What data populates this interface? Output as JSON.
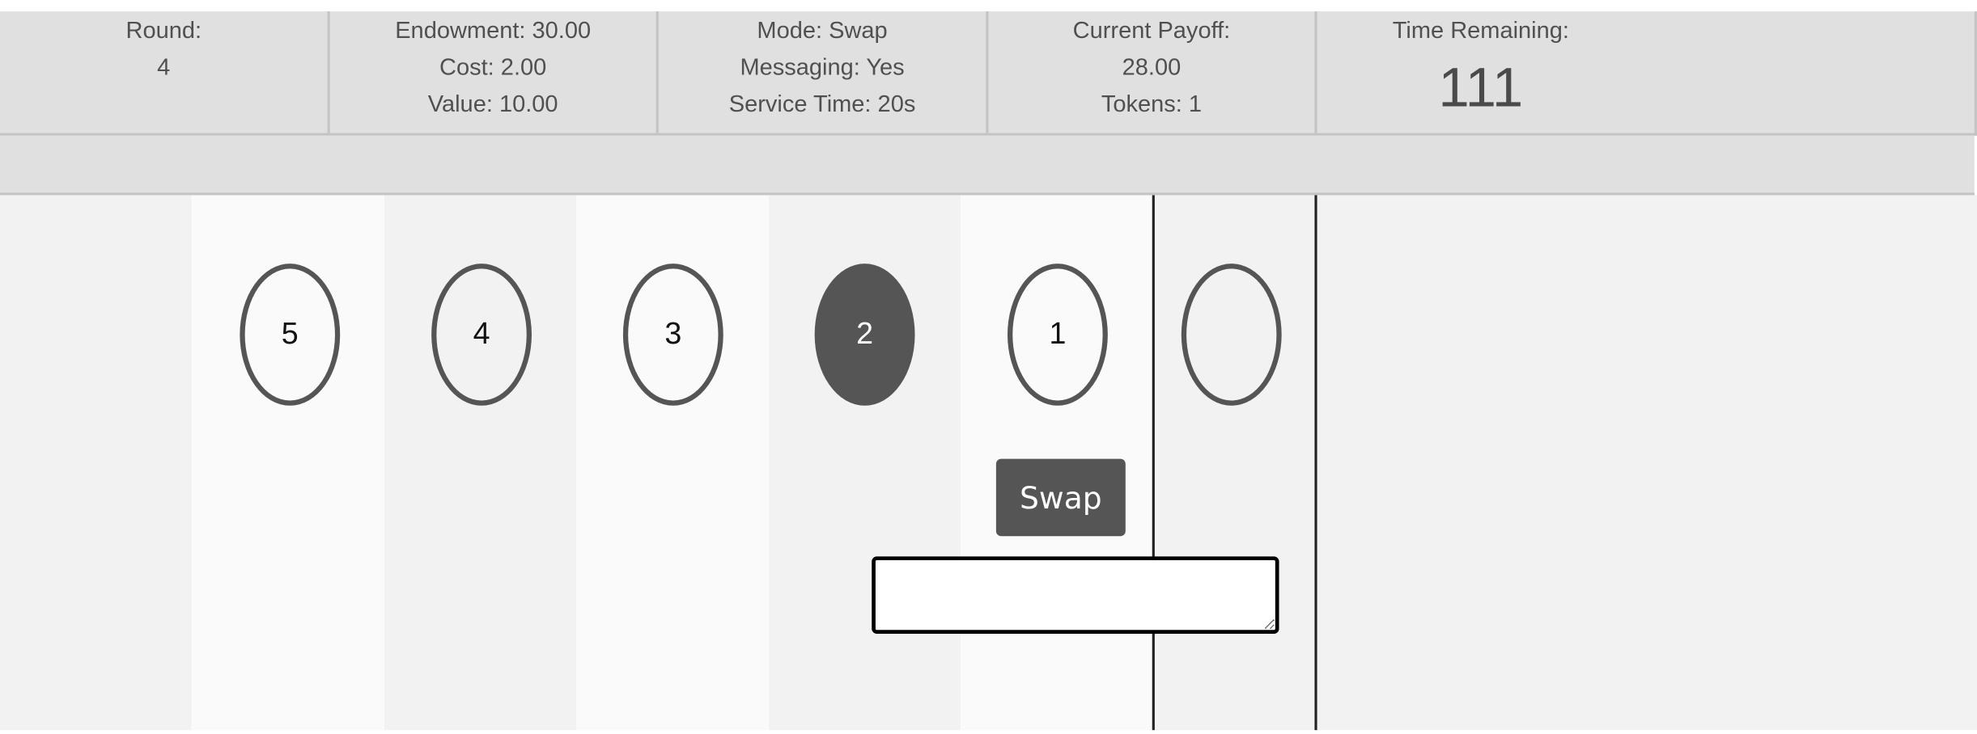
{
  "header": {
    "round": {
      "label": "Round:",
      "value": "4"
    },
    "params": {
      "endowment": "Endowment: 30.00",
      "cost": "Cost: 2.00",
      "value": "Value: 10.00"
    },
    "settings": {
      "mode": "Mode: Swap",
      "messaging": "Messaging: Yes",
      "service_time": "Service Time: 20s"
    },
    "payoff": {
      "label": "Current Payoff:",
      "value": "28.00",
      "tokens": "Tokens: 1"
    },
    "timer": {
      "label": "Time Remaining:",
      "value": "111"
    }
  },
  "queue": {
    "positions": [
      {
        "label": "5",
        "selected": false
      },
      {
        "label": "4",
        "selected": false
      },
      {
        "label": "3",
        "selected": false
      },
      {
        "label": "2",
        "selected": true
      },
      {
        "label": "1",
        "selected": false
      },
      {
        "label": "",
        "selected": false
      }
    ]
  },
  "actions": {
    "swap_label": "Swap",
    "message_value": ""
  },
  "colors": {
    "header_bg": "#e0e0e0",
    "token_border": "#555555",
    "token_selected": "#555555",
    "button_bg": "#555555"
  }
}
